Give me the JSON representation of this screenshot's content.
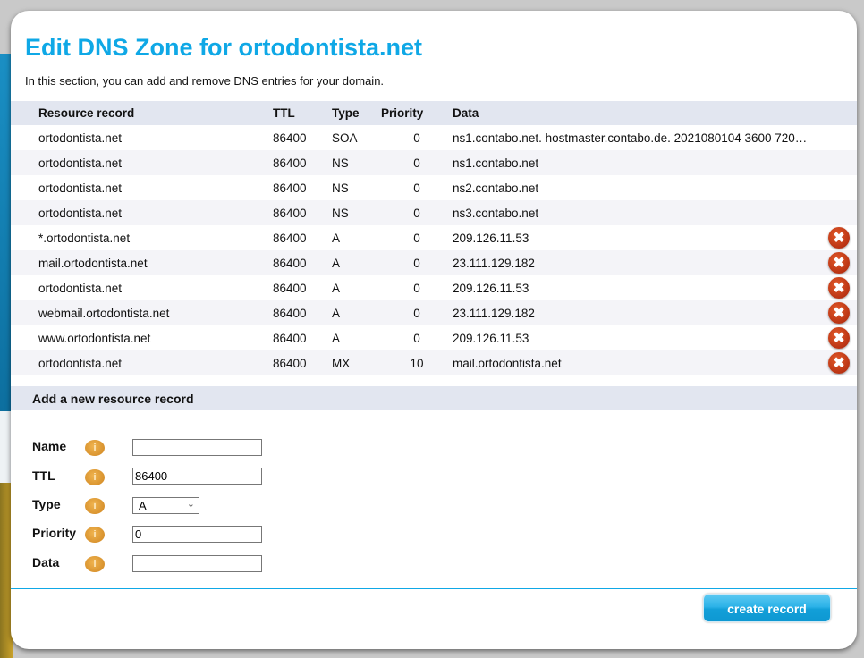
{
  "title": "Edit DNS Zone for ortodontista.net",
  "intro": "In this section, you can add and remove DNS entries for your domain.",
  "columns": [
    "Resource record",
    "TTL",
    "Type",
    "Priority",
    "Data"
  ],
  "records": [
    {
      "name": "ortodontista.net",
      "ttl": "86400",
      "type": "SOA",
      "priority": "0",
      "data": "ns1.contabo.net. hostmaster.contabo.de. 2021080104 3600 720…",
      "deletable": false
    },
    {
      "name": "ortodontista.net",
      "ttl": "86400",
      "type": "NS",
      "priority": "0",
      "data": "ns1.contabo.net",
      "deletable": false
    },
    {
      "name": "ortodontista.net",
      "ttl": "86400",
      "type": "NS",
      "priority": "0",
      "data": "ns2.contabo.net",
      "deletable": false
    },
    {
      "name": "ortodontista.net",
      "ttl": "86400",
      "type": "NS",
      "priority": "0",
      "data": "ns3.contabo.net",
      "deletable": false
    },
    {
      "name": "*.ortodontista.net",
      "ttl": "86400",
      "type": "A",
      "priority": "0",
      "data": "209.126.11.53",
      "deletable": true
    },
    {
      "name": "mail.ortodontista.net",
      "ttl": "86400",
      "type": "A",
      "priority": "0",
      "data": "23.111.129.182",
      "deletable": true
    },
    {
      "name": "ortodontista.net",
      "ttl": "86400",
      "type": "A",
      "priority": "0",
      "data": "209.126.11.53",
      "deletable": true
    },
    {
      "name": "webmail.ortodontista.net",
      "ttl": "86400",
      "type": "A",
      "priority": "0",
      "data": "23.111.129.182",
      "deletable": true
    },
    {
      "name": "www.ortodontista.net",
      "ttl": "86400",
      "type": "A",
      "priority": "0",
      "data": "209.126.11.53",
      "deletable": true
    },
    {
      "name": "ortodontista.net",
      "ttl": "86400",
      "type": "MX",
      "priority": "10",
      "data": "mail.ortodontista.net",
      "deletable": true
    }
  ],
  "add": {
    "header": "Add a new resource record",
    "name_label": "Name",
    "name_value": "",
    "ttl_label": "TTL",
    "ttl_value": "86400",
    "type_label": "Type",
    "type_value": "A",
    "priority_label": "Priority",
    "priority_value": "0",
    "data_label": "Data",
    "data_value": "",
    "info_glyph": "i",
    "submit": "create record"
  },
  "delete_glyph": "✖"
}
